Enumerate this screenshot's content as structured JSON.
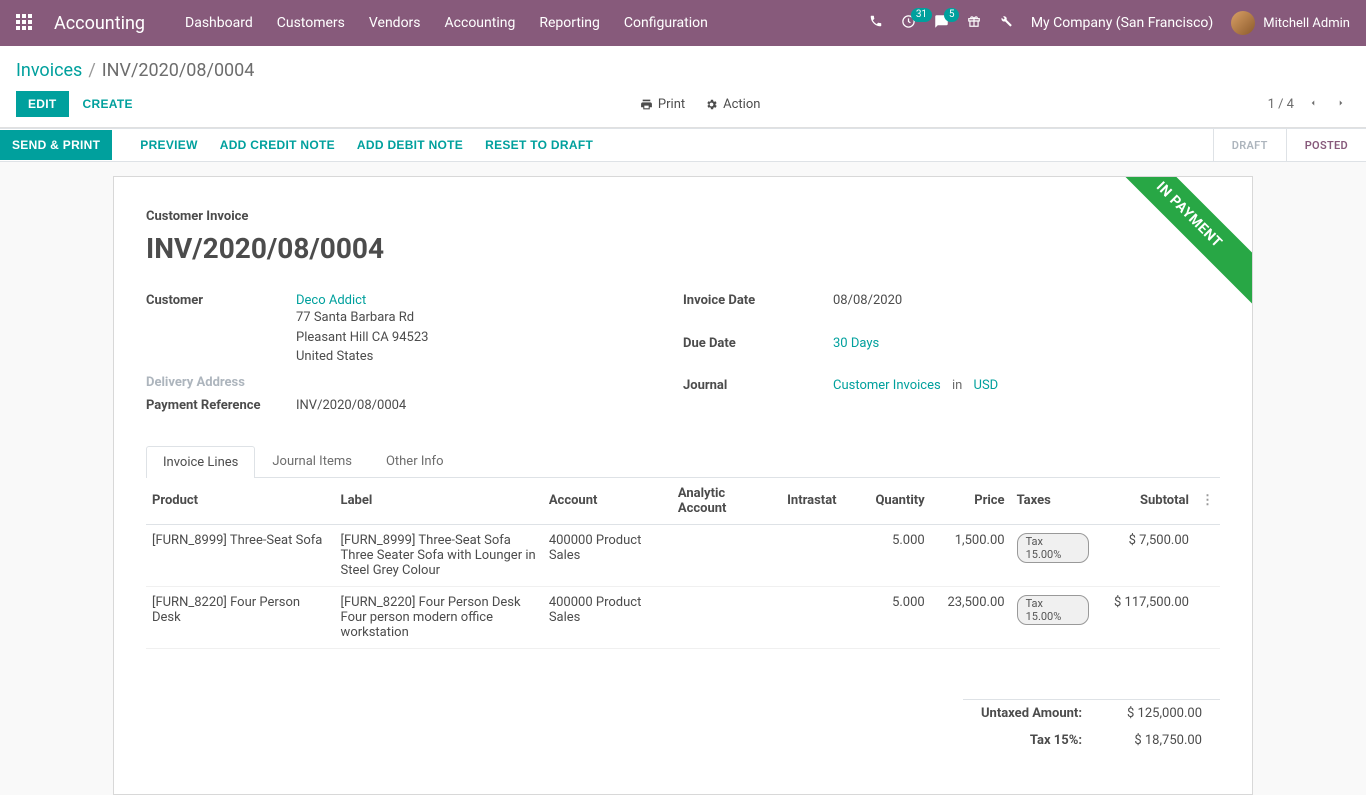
{
  "topnav": {
    "app": "Accounting",
    "menus": [
      "Dashboard",
      "Customers",
      "Vendors",
      "Accounting",
      "Reporting",
      "Configuration"
    ],
    "badge1": "31",
    "badge2": "5",
    "company": "My Company (San Francisco)",
    "user": "Mitchell Admin"
  },
  "breadcrumb": {
    "root": "Invoices",
    "current": "INV/2020/08/0004"
  },
  "toolbar": {
    "edit": "EDIT",
    "create": "CREATE",
    "print": "Print",
    "action": "Action",
    "pager": "1 / 4"
  },
  "statusbar": {
    "send_print": "SEND & PRINT",
    "preview": "PREVIEW",
    "add_credit": "ADD CREDIT NOTE",
    "add_debit": "ADD DEBIT NOTE",
    "reset": "RESET TO DRAFT",
    "stage_draft": "DRAFT",
    "stage_posted": "POSTED"
  },
  "ribbon": "IN PAYMENT",
  "sheet": {
    "doc_type": "Customer Invoice",
    "doc_title": "INV/2020/08/0004",
    "customer_label": "Customer",
    "customer_name": "Deco Addict",
    "customer_addr1": "77 Santa Barbara Rd",
    "customer_addr2": "Pleasant Hill CA 94523",
    "customer_addr3": "United States",
    "delivery_label": "Delivery Address",
    "payref_label": "Payment Reference",
    "payref": "INV/2020/08/0004",
    "invdate_label": "Invoice Date",
    "invdate": "08/08/2020",
    "duedate_label": "Due Date",
    "duedate": "30 Days",
    "journal_label": "Journal",
    "journal": "Customer Invoices",
    "in_word": "in",
    "currency": "USD"
  },
  "tabs": {
    "lines": "Invoice Lines",
    "journal": "Journal Items",
    "other": "Other Info"
  },
  "table": {
    "headers": {
      "product": "Product",
      "label": "Label",
      "account": "Account",
      "analytic": "Analytic Account",
      "intrastat": "Intrastat",
      "qty": "Quantity",
      "price": "Price",
      "taxes": "Taxes",
      "subtotal": "Subtotal"
    },
    "rows": [
      {
        "product": "[FURN_8999] Three-Seat Sofa",
        "label_l1": "[FURN_8999] Three-Seat Sofa",
        "label_l2": "Three Seater Sofa with Lounger in Steel Grey Colour",
        "account": "400000 Product Sales",
        "qty": "5.000",
        "price": "1,500.00",
        "tax": "Tax 15.00%",
        "subtotal": "$ 7,500.00"
      },
      {
        "product": "[FURN_8220] Four Person Desk",
        "label_l1": "[FURN_8220] Four Person Desk",
        "label_l2": "Four person modern office workstation",
        "account": "400000 Product Sales",
        "qty": "5.000",
        "price": "23,500.00",
        "tax": "Tax 15.00%",
        "subtotal": "$ 117,500.00"
      }
    ]
  },
  "totals": {
    "untaxed_label": "Untaxed Amount:",
    "untaxed": "$ 125,000.00",
    "tax_label": "Tax 15%:",
    "tax": "$ 18,750.00"
  }
}
